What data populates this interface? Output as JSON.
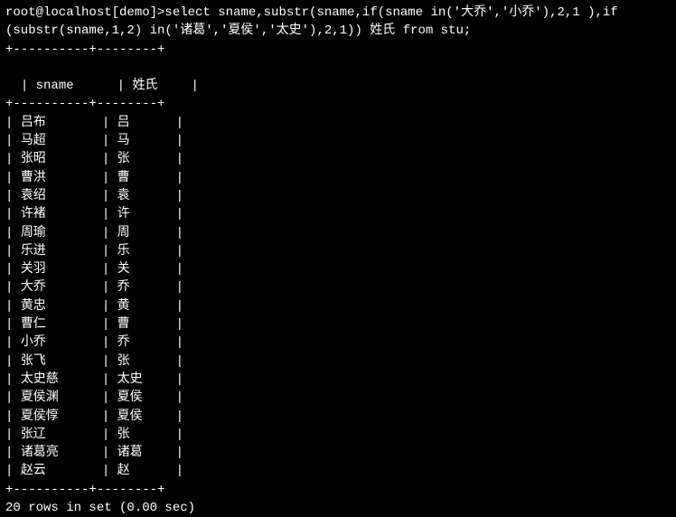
{
  "prompt": {
    "line1": "root@localhost[demo]>select sname,substr(sname,if(sname in('大乔','小乔'),2,1 ),if",
    "line2": "(substr(sname,1,2) in('诸葛','夏侯','太史'),2,1)) 姓氏 from stu;"
  },
  "separator": "+----------+--------+",
  "headers": {
    "col1": "sname",
    "col2": "姓氏"
  },
  "rows": [
    {
      "sname": "吕布",
      "surname": "吕"
    },
    {
      "sname": "马超",
      "surname": "马"
    },
    {
      "sname": "张昭",
      "surname": "张"
    },
    {
      "sname": "曹洪",
      "surname": "曹"
    },
    {
      "sname": "袁绍",
      "surname": "袁"
    },
    {
      "sname": "许褚",
      "surname": "许"
    },
    {
      "sname": "周瑜",
      "surname": "周"
    },
    {
      "sname": "乐进",
      "surname": "乐"
    },
    {
      "sname": "关羽",
      "surname": "关"
    },
    {
      "sname": "大乔",
      "surname": "乔"
    },
    {
      "sname": "黄忠",
      "surname": "黄"
    },
    {
      "sname": "曹仁",
      "surname": "曹"
    },
    {
      "sname": "小乔",
      "surname": "乔"
    },
    {
      "sname": "张飞",
      "surname": "张"
    },
    {
      "sname": "太史慈",
      "surname": "太史"
    },
    {
      "sname": "夏侯渊",
      "surname": "夏侯"
    },
    {
      "sname": "夏侯惇",
      "surname": "夏侯"
    },
    {
      "sname": "张辽",
      "surname": "张"
    },
    {
      "sname": "诸葛亮",
      "surname": "诸葛"
    },
    {
      "sname": "赵云",
      "surname": "赵"
    }
  ],
  "footer": "20 rows in set (0.00 sec)"
}
